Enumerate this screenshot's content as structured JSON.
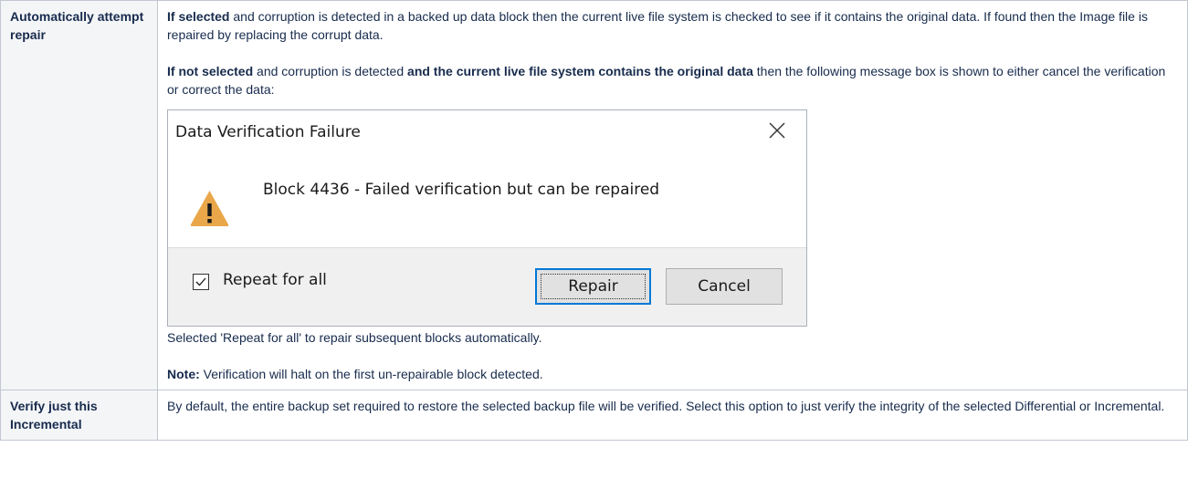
{
  "rows": [
    {
      "heading": "Automatically attempt repair",
      "para1_bold": "If selected",
      "para1_text": " and corruption is detected in a backed up data block then the current live file system is checked to see if it contains the original data. If found then the Image file is repaired by replacing the corrupt data.",
      "para2_bold1": "If not selected",
      "para2_text1": " and corruption is detected ",
      "para2_bold2": "and the current live file system contains the original data",
      "para2_text2": " then the following message box is shown to either cancel the verification or correct the data:",
      "after_dialog": "Selected 'Repeat for all' to repair subsequent blocks automatically.",
      "note_bold": "Note:",
      "note_text": " Verification will halt on the first un-repairable block detected."
    },
    {
      "heading": "Verify just this Incremental",
      "text": "By default, the entire backup set required to restore the selected backup file will be verified. Select this option to just verify the integrity of the selected Differential or Incremental."
    }
  ],
  "dialog": {
    "title": "Data Verification Failure",
    "message": "Block 4436 - Failed verification but can be repaired",
    "checkbox_label": "Repeat for all",
    "checkbox_checked": true,
    "repair_label": "Repair",
    "cancel_label": "Cancel",
    "icons": {
      "close": "close-icon",
      "warning": "warning-icon",
      "check": "checkmark-icon"
    },
    "colors": {
      "warning_fill": "#e9a74a",
      "focus_border": "#0078d7"
    }
  }
}
